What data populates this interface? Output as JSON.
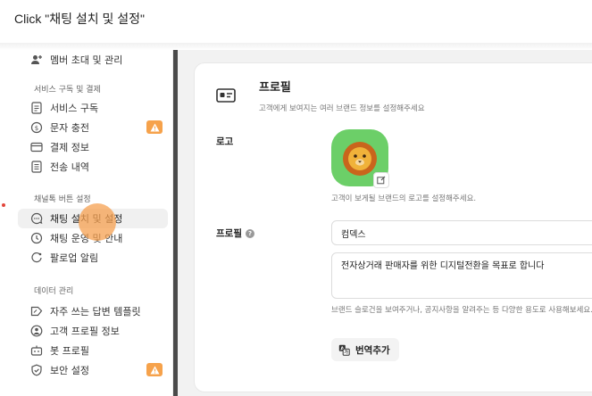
{
  "instruction": "Click \"채팅 설치 및 설정\"",
  "sidebar": {
    "top_item": {
      "label": "멤버 초대 및 관리",
      "icon": "add-user-icon"
    },
    "sections": [
      {
        "title": "서비스 구독 및 결제",
        "items": [
          {
            "label": "서비스 구독",
            "icon": "document-icon",
            "badge": false
          },
          {
            "label": "문자 충전",
            "icon": "coin-icon",
            "badge": true
          },
          {
            "label": "결제 정보",
            "icon": "card-icon",
            "badge": false
          },
          {
            "label": "전송 내역",
            "icon": "list-icon",
            "badge": false
          }
        ]
      },
      {
        "title": "채널톡 버튼 설정",
        "items": [
          {
            "label": "채팅 설치 및 설정",
            "icon": "chat-icon",
            "badge": false,
            "active": true
          },
          {
            "label": "채팅 운영 및 안내",
            "icon": "clock-icon",
            "badge": false
          },
          {
            "label": "팔로업 알림",
            "icon": "bell-icon",
            "badge": false
          }
        ]
      },
      {
        "title": "데이터 관리",
        "items": [
          {
            "label": "자주 쓰는 답변 템플릿",
            "icon": "tag-icon",
            "badge": false
          },
          {
            "label": "고객 프로필 정보",
            "icon": "person-circle-icon",
            "badge": false
          },
          {
            "label": "봇 프로필",
            "icon": "bot-icon",
            "badge": false
          },
          {
            "label": "보안 설정",
            "icon": "shield-icon",
            "badge": true
          }
        ]
      }
    ]
  },
  "profile": {
    "title": "프로필",
    "subtitle": "고객에게 보여지는 여러 브랜드 정보를 설정해주세요",
    "logo_label": "로고",
    "logo_desc": "고객이 보게될 브랜드의 로고를 설정해주세요.",
    "profile_label": "프로필",
    "name_value": "컴덱스",
    "slogan_value": "전자상거래 판매자를 위한 디지털전환을 목표로 합니다",
    "slogan_desc": "브랜드 슬로건을 보여주거나, 공지사항을 알려주는 등 다양한 용도로 사용해보세요.",
    "translate_button": "번역추가"
  },
  "colors": {
    "accent_warning": "#f6a24b",
    "logo_bg": "#6ccf68",
    "click_marker": "#f5a050"
  }
}
